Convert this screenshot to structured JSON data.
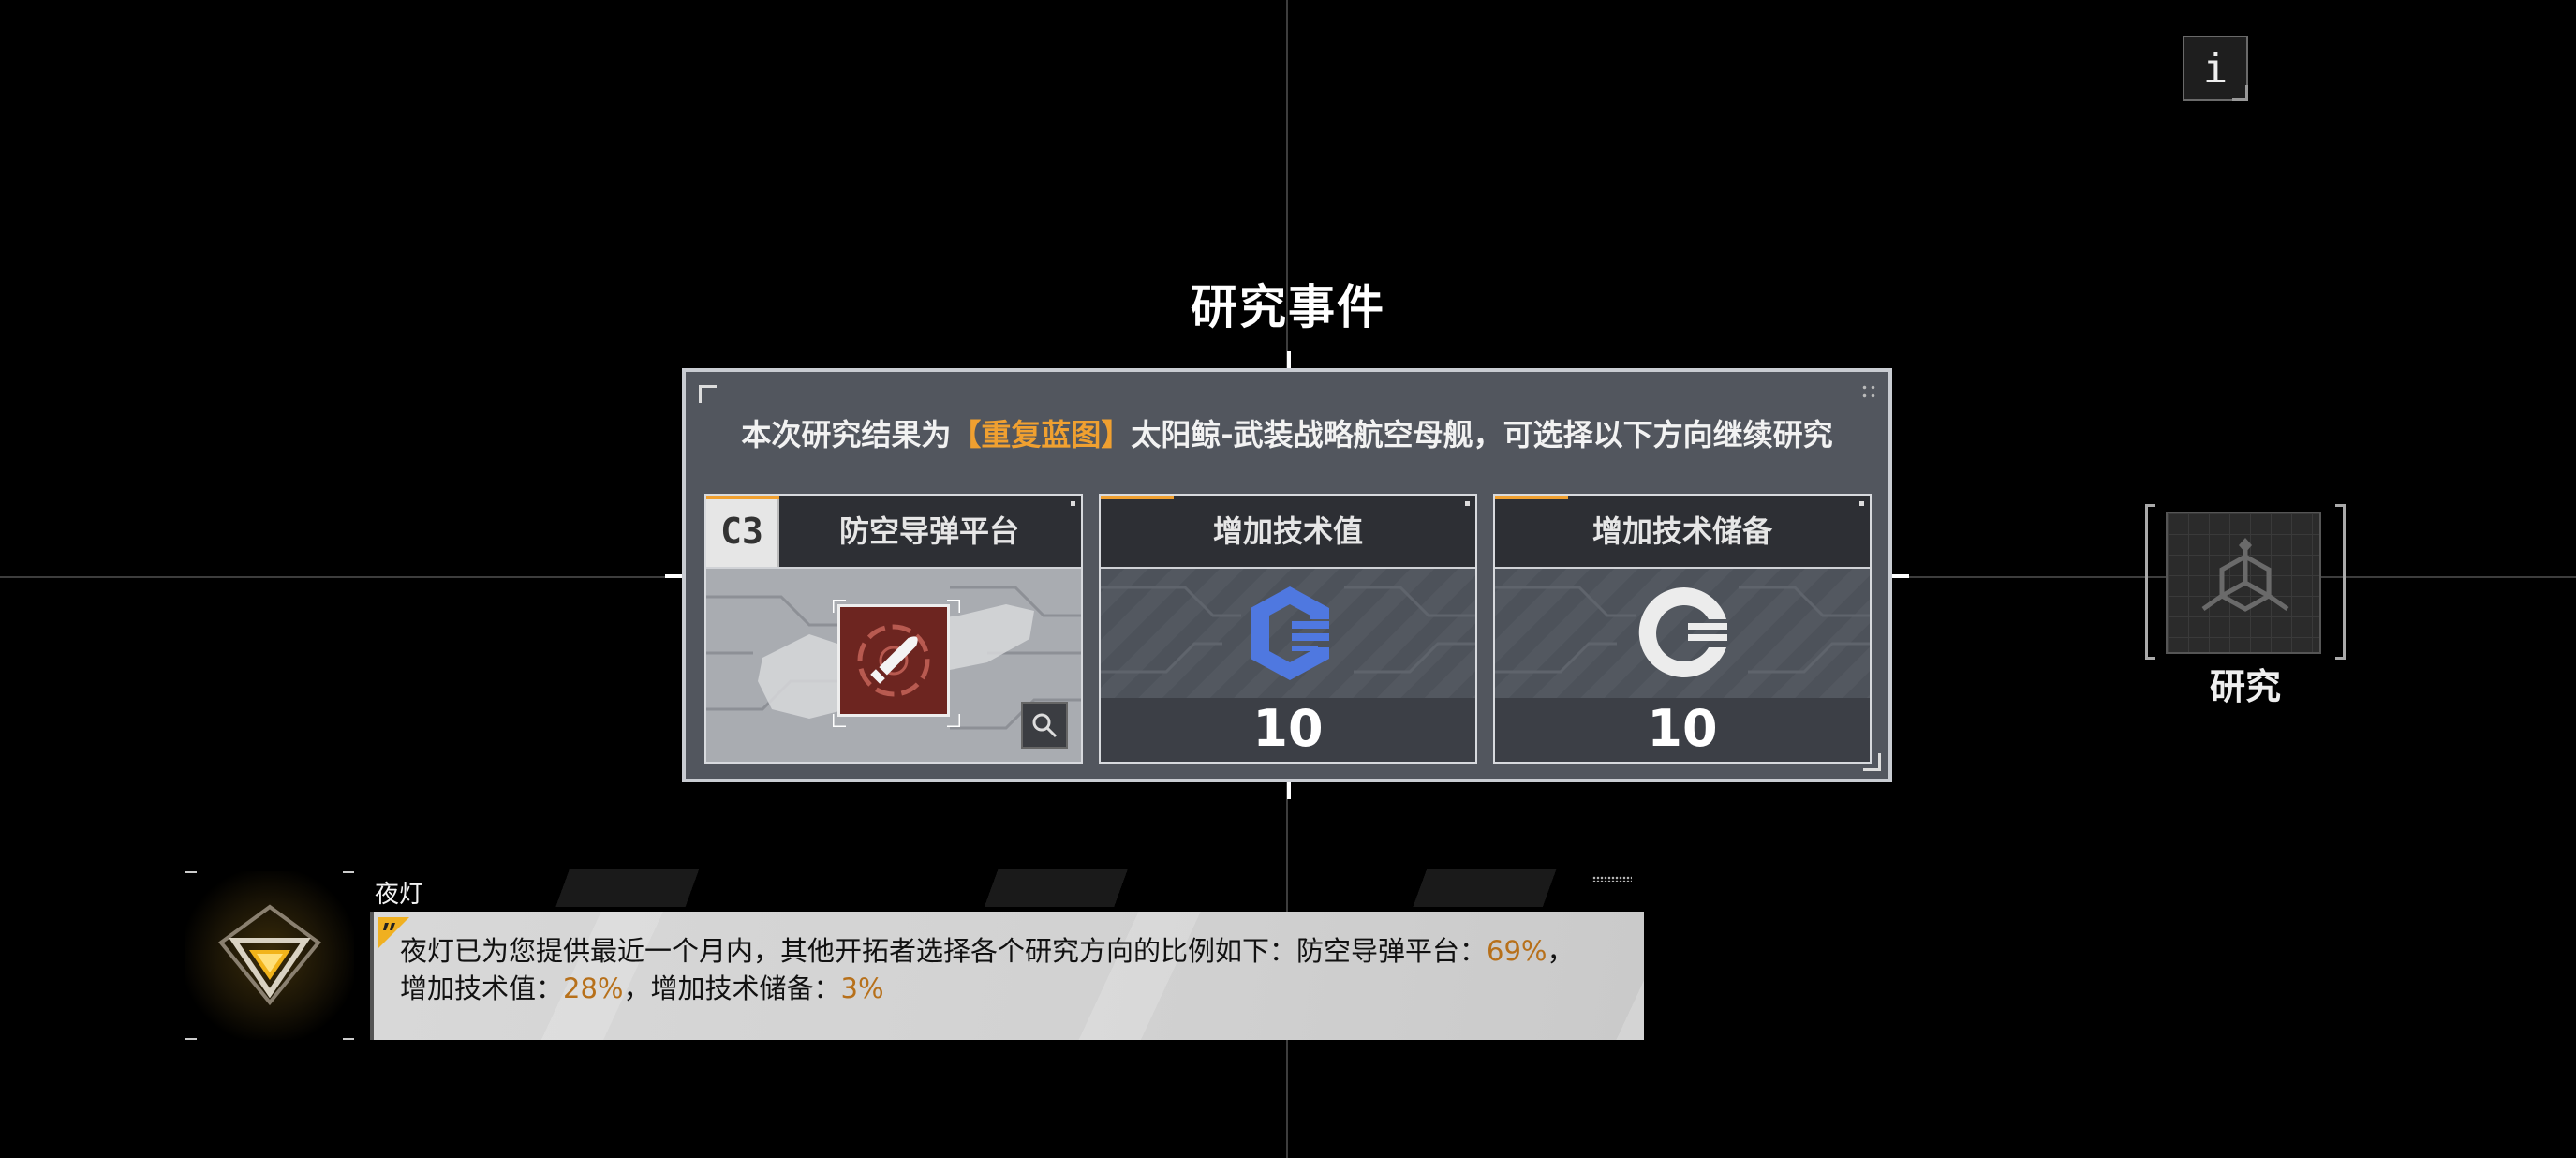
{
  "title": "研究事件",
  "info_button_label": "i",
  "result_line": {
    "prefix": "本次研究结果为",
    "highlight": "【重复蓝图】",
    "suffix": "太阳鲸-武装战略航空母舰，可选择以下方向继续研究"
  },
  "cards": [
    {
      "tag": "C3",
      "label": "防空导弹平台",
      "value": ""
    },
    {
      "label": "增加技术值",
      "value": "10"
    },
    {
      "label": "增加技术储备",
      "value": "10"
    }
  ],
  "side_button": {
    "label": "研究"
  },
  "dialog": {
    "speaker": "夜灯",
    "line1_prefix": "夜灯已为您提供最近一个月内，其他开拓者选择各个研究方向的比例如下：防空导弹平台：",
    "pct1": "69%",
    "line1_suffix": "，",
    "line2_prefix": "增加技术值：",
    "pct2": "28%",
    "line2_mid": "，增加技术储备：",
    "pct3": "3%"
  },
  "colors": {
    "accent": "#f0a030",
    "percent": "#b7701a",
    "blue_icon": "#4f78e0"
  },
  "icons": {
    "info": "info-icon",
    "weapon": "missile-icon",
    "zoom": "magnifier-icon",
    "tech_value": "hexagon-tech-icon",
    "tech_reserve": "circle-tech-icon",
    "research": "research-hex-icon",
    "avatar": "nightlight-triangle-icon"
  }
}
